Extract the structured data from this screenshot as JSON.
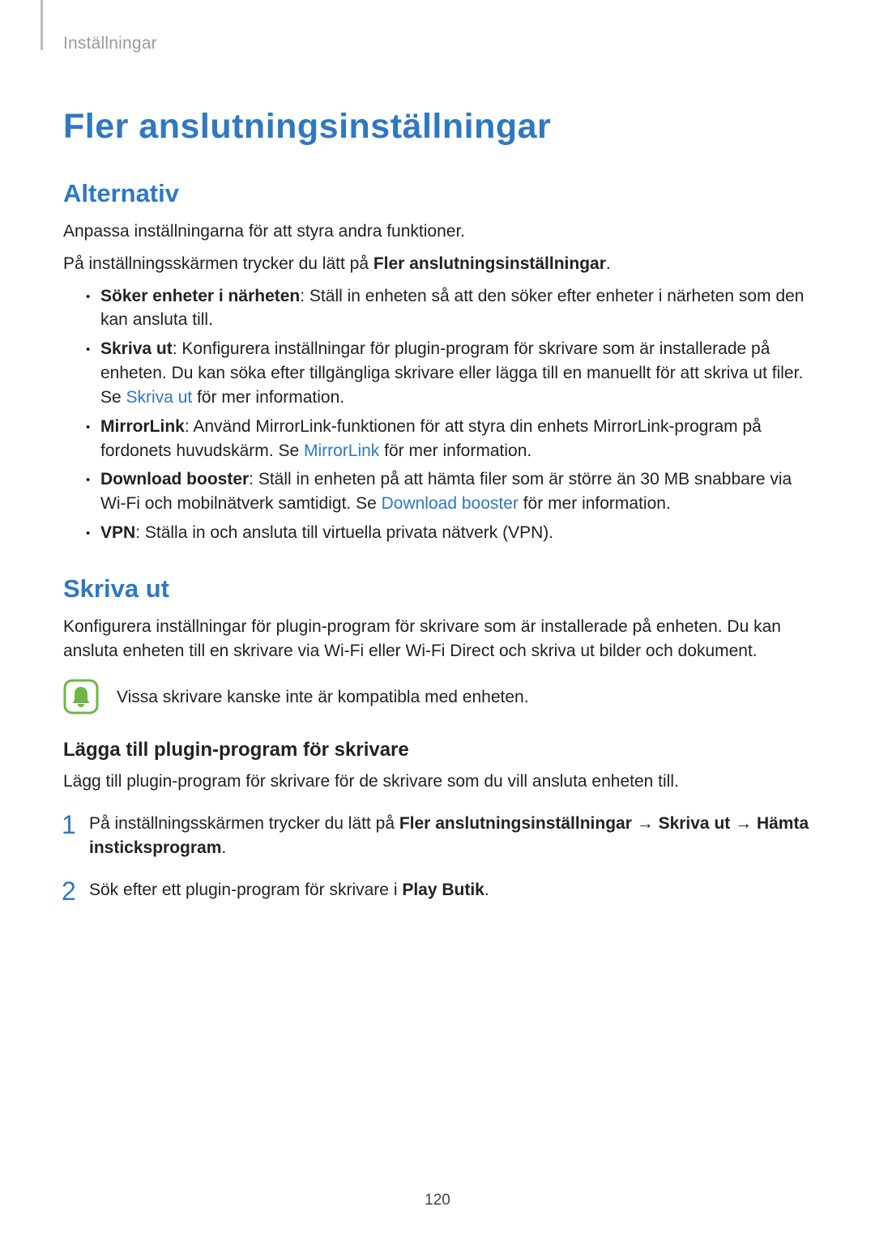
{
  "breadcrumb": "Inställningar",
  "title": "Fler anslutningsinställningar",
  "section_alternativ": {
    "heading": "Alternativ",
    "intro": "Anpassa inställningarna för att styra andra funktioner.",
    "tap_prefix": "På inställningsskärmen trycker du lätt på ",
    "tap_bold": "Fler anslutningsinställningar",
    "tap_suffix": ".",
    "items": [
      {
        "bold": "Söker enheter i närheten",
        "text": ": Ställ in enheten så att den söker efter enheter i närheten som den kan ansluta till."
      },
      {
        "bold": "Skriva ut",
        "pre": ": Konfigurera inställningar för plugin-program för skrivare som är installerade på enheten. Du kan söka efter tillgängliga skrivare eller lägga till en manuellt för att skriva ut filer. Se ",
        "link": "Skriva ut",
        "post": " för mer information."
      },
      {
        "bold": "MirrorLink",
        "pre": ": Använd MirrorLink-funktionen för att styra din enhets MirrorLink-program på fordonets huvudskärm. Se ",
        "link": "MirrorLink",
        "post": " för mer information."
      },
      {
        "bold": "Download booster",
        "pre": ": Ställ in enheten på att hämta filer som är större än 30 MB snabbare via Wi-Fi och mobilnätverk samtidigt. Se ",
        "link": "Download booster",
        "post": " för mer information."
      },
      {
        "bold": "VPN",
        "text": ": Ställa in och ansluta till virtuella privata nätverk (VPN)."
      }
    ]
  },
  "section_skriva_ut": {
    "heading": "Skriva ut",
    "intro": "Konfigurera inställningar för plugin-program för skrivare som är installerade på enheten. Du kan ansluta enheten till en skrivare via Wi-Fi eller Wi-Fi Direct och skriva ut bilder och dokument.",
    "note": "Vissa skrivare kanske inte är kompatibla med enheten.",
    "sub_heading": "Lägga till plugin-program för skrivare",
    "sub_intro": "Lägg till plugin-program för skrivare för de skrivare som du vill ansluta enheten till.",
    "steps": [
      {
        "num": "1",
        "pre": "På inställningsskärmen trycker du lätt på ",
        "bold1": "Fler anslutningsinställningar",
        "arrow1": " → ",
        "bold2": "Skriva ut",
        "arrow2": " → ",
        "bold3": "Hämta insticksprogram",
        "suffix": "."
      },
      {
        "num": "2",
        "pre": "Sök efter ett plugin-program för skrivare i ",
        "bold1": "Play Butik",
        "suffix": "."
      }
    ]
  },
  "page_number": "120"
}
